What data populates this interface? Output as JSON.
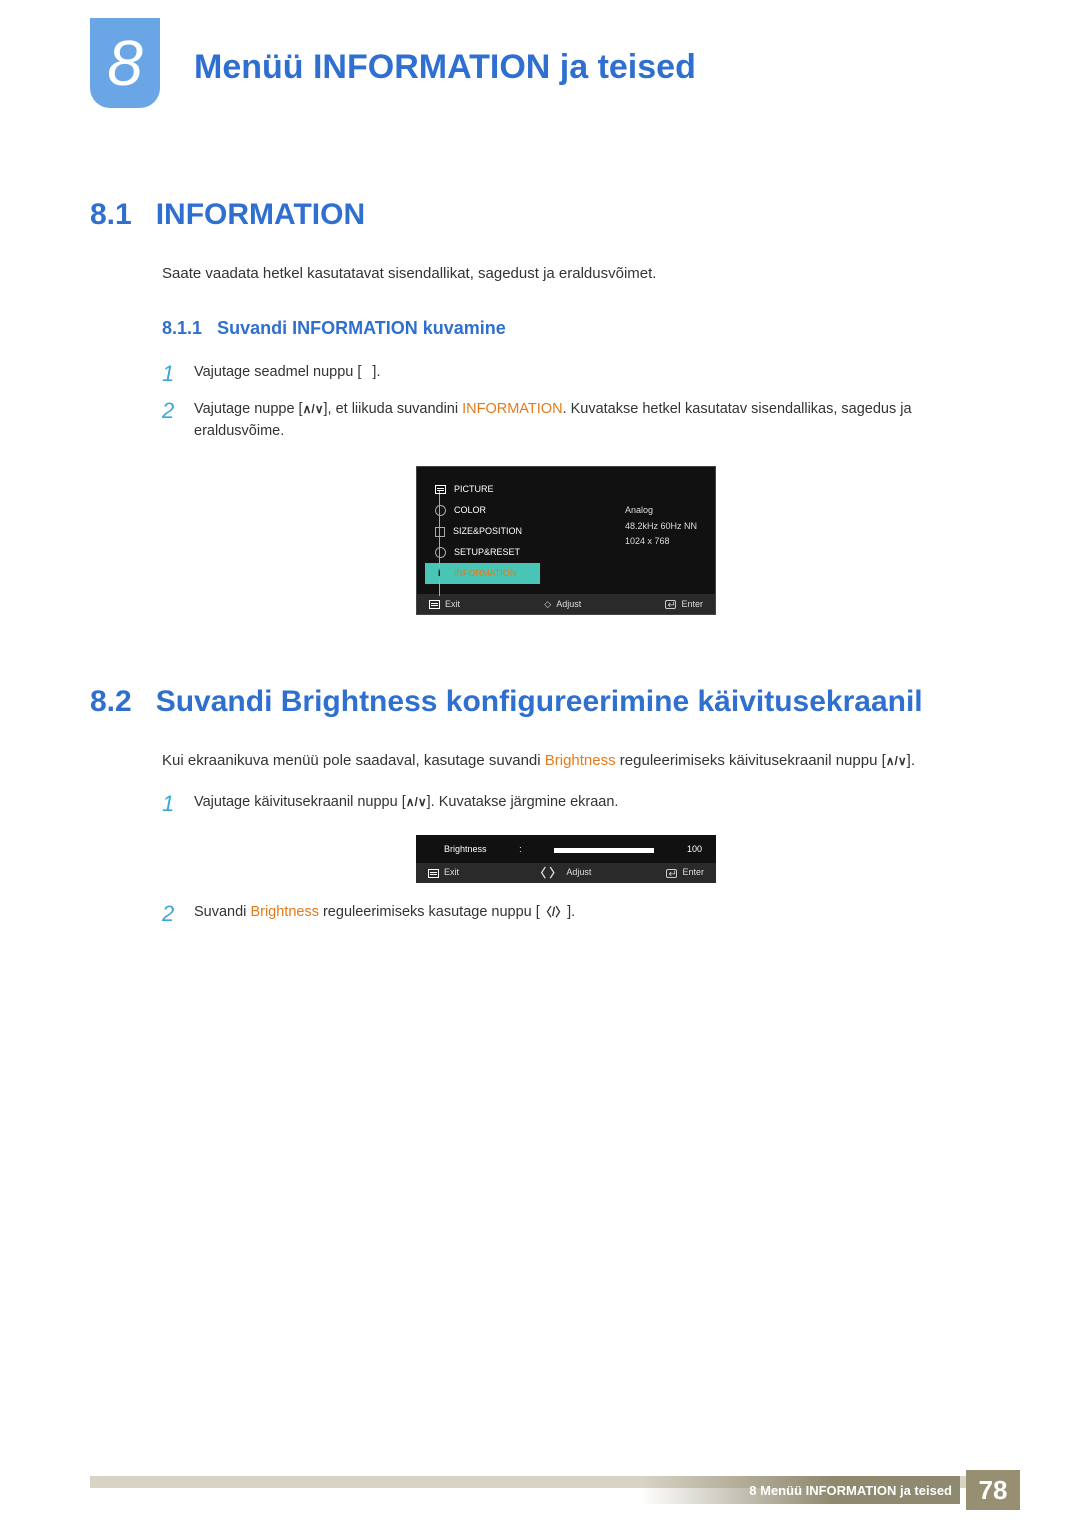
{
  "chapter": {
    "number": "8",
    "title": "Menüü INFORMATION ja teised"
  },
  "sec81": {
    "num": "8.1",
    "title": "INFORMATION",
    "intro": "Saate vaadata hetkel kasutatavat sisendallikat, sagedust ja eraldusvõimet.",
    "sub_num": "8.1.1",
    "sub_title": "Suvandi INFORMATION kuvamine",
    "step1_a": "Vajutage seadmel nuppu [",
    "step1_b": "].",
    "step2_a": "Vajutage nuppe [",
    "step2_b": "], et liikuda suvandini ",
    "step2_hl": "INFORMATION",
    "step2_c": ". Kuvatakse hetkel kasutatav sisendallikas, sagedus ja eraldusvõime."
  },
  "osd": {
    "items": [
      "PICTURE",
      "COLOR",
      "SIZE&POSITION",
      "SETUP&RESET",
      "INFORMATION"
    ],
    "info": {
      "l1": "Analog",
      "l2": "48.2kHz 60Hz NN",
      "l3": "1024 x 768"
    },
    "bar": {
      "exit": "Exit",
      "adjust": "Adjust",
      "enter": "Enter"
    }
  },
  "sec82": {
    "num": "8.2",
    "title": "Suvandi Brightness konfigureerimine käivitusekraanil",
    "intro_a": "Kui ekraanikuva menüü pole saadaval, kasutage suvandi ",
    "intro_hl": "Brightness",
    "intro_b": " reguleerimiseks käivitusekraanil nuppu [",
    "intro_c": "].",
    "step1_a": "Vajutage käivitusekraanil nuppu [",
    "step1_b": "]. Kuvatakse järgmine ekraan.",
    "step2_a": "Suvandi ",
    "step2_hl": "Brightness",
    "step2_b": " reguleerimiseks kasutage nuppu [",
    "step2_c": "]."
  },
  "bosd": {
    "label": "Brightness",
    "sep": ":",
    "value": "100",
    "bar": {
      "exit": "Exit",
      "adjust": "Adjust",
      "enter": "Enter"
    }
  },
  "footer": {
    "text": "8 Menüü INFORMATION ja teised",
    "page": "78"
  }
}
